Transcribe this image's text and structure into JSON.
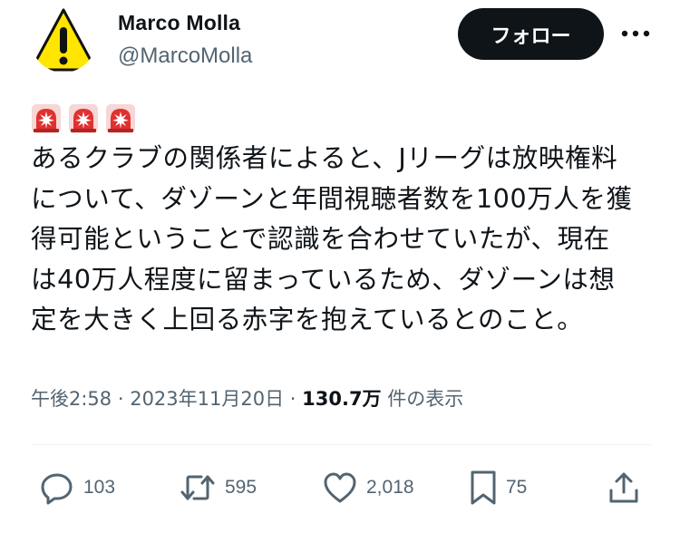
{
  "author": {
    "name": "Marco Molla",
    "handle": "@MarcoMolla",
    "avatar_icon": "warning-sign-icon"
  },
  "follow_label": "フォロー",
  "more_icon": "more-dots-icon",
  "sirens": [
    "police-siren-icon",
    "police-siren-icon",
    "police-siren-icon"
  ],
  "body_lines": [
    "あるクラブの関係者によると、Jリーグは放映権料",
    "について、ダゾーンと年間視聴者数を100万人を獲",
    "得可能ということで認識を合わせていたが、現在",
    "は40万人程度に留まっているため、ダゾーンは想",
    "定を大きく上回る赤字を抱えているとのこと。"
  ],
  "meta": {
    "time": "午後2:58",
    "sep1": " · ",
    "date": "2023年11月20日",
    "sep2": " · ",
    "views": "130.7万",
    "views_suffix": " 件の表示"
  },
  "actions": {
    "reply_count": "103",
    "retweet_count": "595",
    "like_count": "2,018",
    "bookmark_count": "75"
  },
  "colors": {
    "text": "#0f1419",
    "muted": "#536471",
    "avatar_yellow": "#ffe500",
    "siren_red": "#e0312f"
  }
}
